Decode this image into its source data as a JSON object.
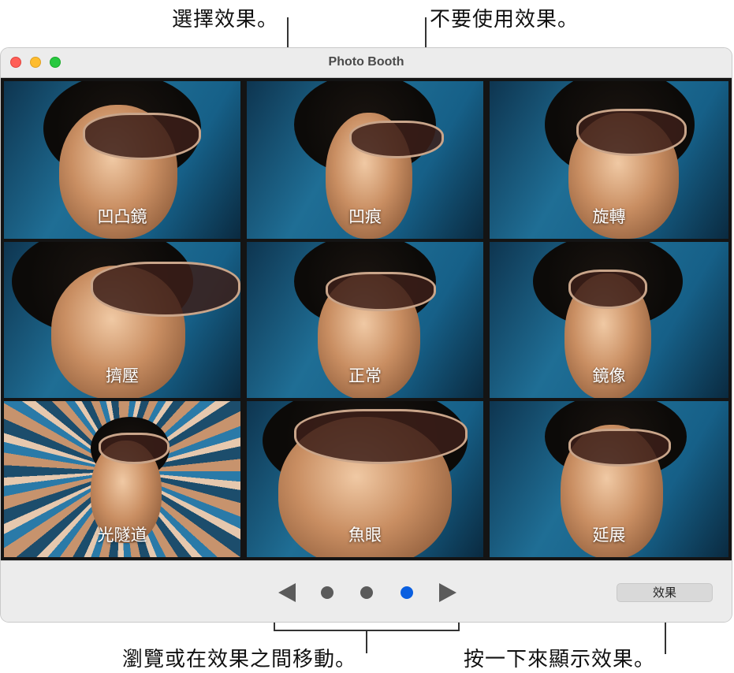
{
  "callouts": {
    "select_effect": "選擇效果。",
    "no_effect": "不要使用效果。",
    "browse": "瀏覽或在效果之間移動。",
    "click_show": "按一下來顯示效果。"
  },
  "window": {
    "title": "Photo Booth"
  },
  "effects": [
    {
      "label": "凹凸鏡"
    },
    {
      "label": "凹痕"
    },
    {
      "label": "旋轉"
    },
    {
      "label": "擠壓"
    },
    {
      "label": "正常"
    },
    {
      "label": "鏡像"
    },
    {
      "label": "光隧道"
    },
    {
      "label": "魚眼"
    },
    {
      "label": "延展"
    }
  ],
  "pager": {
    "page_count": 3,
    "active_page": 3
  },
  "toolbar": {
    "effects_label": "效果"
  },
  "colors": {
    "accent": "#0a5fe0",
    "close": "#ff5f57",
    "minimize": "#febc2e",
    "maximize": "#28c840"
  }
}
